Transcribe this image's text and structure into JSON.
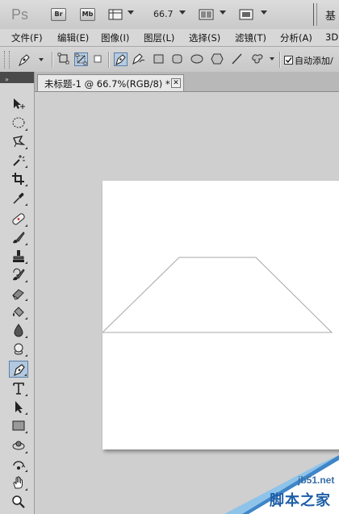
{
  "app": {
    "logo": "Ps",
    "workspace_label": "基"
  },
  "appbar": {
    "bridge_label": "Br",
    "minibridge_label": "Mb",
    "zoom": "66.7"
  },
  "menu": [
    "文件(F)",
    "编辑(E)",
    "图像(I)",
    "图层(L)",
    "选择(S)",
    "滤镜(T)",
    "分析(A)",
    "3D"
  ],
  "options": {
    "auto_add_delete_label": "自动添加/",
    "auto_add_delete_checked": true
  },
  "document": {
    "tab_title": "未标题-1 @ 66.7%(RGB/8) *",
    "close_glyph": "✕"
  },
  "watermark": {
    "domain": "jb51.net",
    "brand": "脚本之家"
  },
  "tools": [
    "move-tool",
    "marquee-tool",
    "lasso-tool",
    "magic-wand-tool",
    "crop-tool",
    "eyedropper-tool",
    "healing-brush-tool",
    "brush-tool",
    "clone-stamp-tool",
    "history-brush-tool",
    "eraser-tool",
    "paint-bucket-tool",
    "blur-tool",
    "dodge-tool",
    "pen-tool",
    "type-tool",
    "path-selection-tool",
    "shape-tool",
    "3d-rotate-tool",
    "3d-orbit-tool",
    "hand-tool",
    "zoom-tool"
  ],
  "active_tool": "pen-tool",
  "colors": {
    "selection_accent": "#5a7ea6",
    "canvas_background": "#cfcfcf",
    "document": "#ffffff"
  }
}
